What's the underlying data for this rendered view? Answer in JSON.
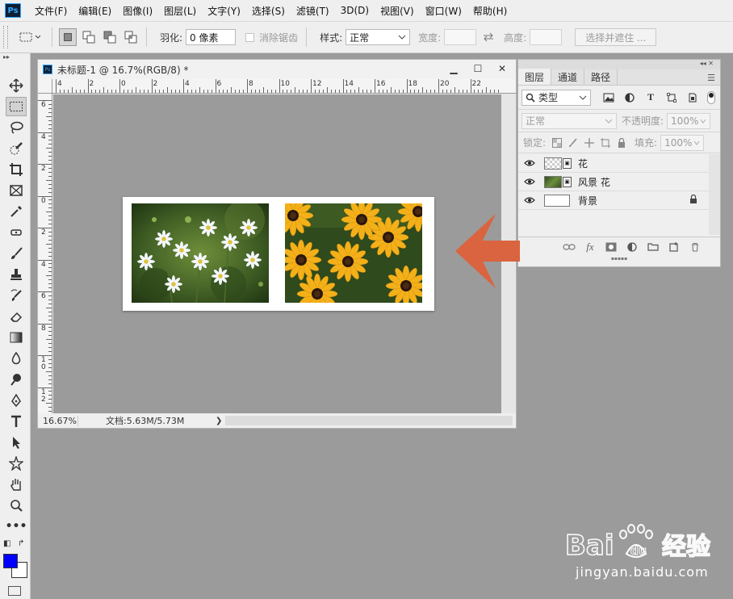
{
  "menubar": {
    "logo": "Ps",
    "items": [
      "文件(F)",
      "编辑(E)",
      "图像(I)",
      "图层(L)",
      "文字(Y)",
      "选择(S)",
      "滤镜(T)",
      "3D(D)",
      "视图(V)",
      "窗口(W)",
      "帮助(H)"
    ]
  },
  "options": {
    "feather_label": "羽化:",
    "feather_value": "0 像素",
    "antialias_label": "消除锯齿",
    "style_label": "样式:",
    "style_value": "正常",
    "width_label": "宽度:",
    "height_label": "高度:",
    "select_mask_label": "选择并遮住 ..."
  },
  "document": {
    "logo": "Ps",
    "title": "未标题-1 @ 16.7%(RGB/8) *",
    "min": "▁",
    "max": "☐",
    "close": "✕",
    "zoom": "16.67%",
    "docinfo": "文档:5.63M/5.73M",
    "status_arrow": "❯",
    "ruler_h": [
      "4",
      "2",
      "0",
      "2",
      "4",
      "6",
      "8",
      "10",
      "12",
      "14",
      "16",
      "18",
      "20",
      "22"
    ],
    "ruler_v": [
      "6",
      "4",
      "2",
      "0",
      "2",
      "4",
      "6",
      "8",
      "1\n0",
      "1\n2"
    ]
  },
  "layers_panel": {
    "tabs": [
      "图层",
      "通道",
      "路径"
    ],
    "filter_label": "类型",
    "blend_mode": "正常",
    "opacity_label": "不透明度:",
    "opacity_value": "100%",
    "lock_label": "锁定:",
    "fill_label": "填充:",
    "fill_value": "100%",
    "layers": [
      {
        "name": "花",
        "thumb": "checker",
        "smart": true
      },
      {
        "name": "风景 花",
        "thumb": "greenpic",
        "smart": true
      },
      {
        "name": "背景",
        "thumb": "white",
        "smart": false,
        "locked": true
      }
    ]
  },
  "watermark": {
    "text": "jingyan.baidu.com",
    "logo": "Bai du 经验"
  },
  "colors": {
    "foreground": "#0000ff",
    "background": "#ffffff",
    "arrow": "#d9643f",
    "workspace": "#9b9b9b"
  }
}
